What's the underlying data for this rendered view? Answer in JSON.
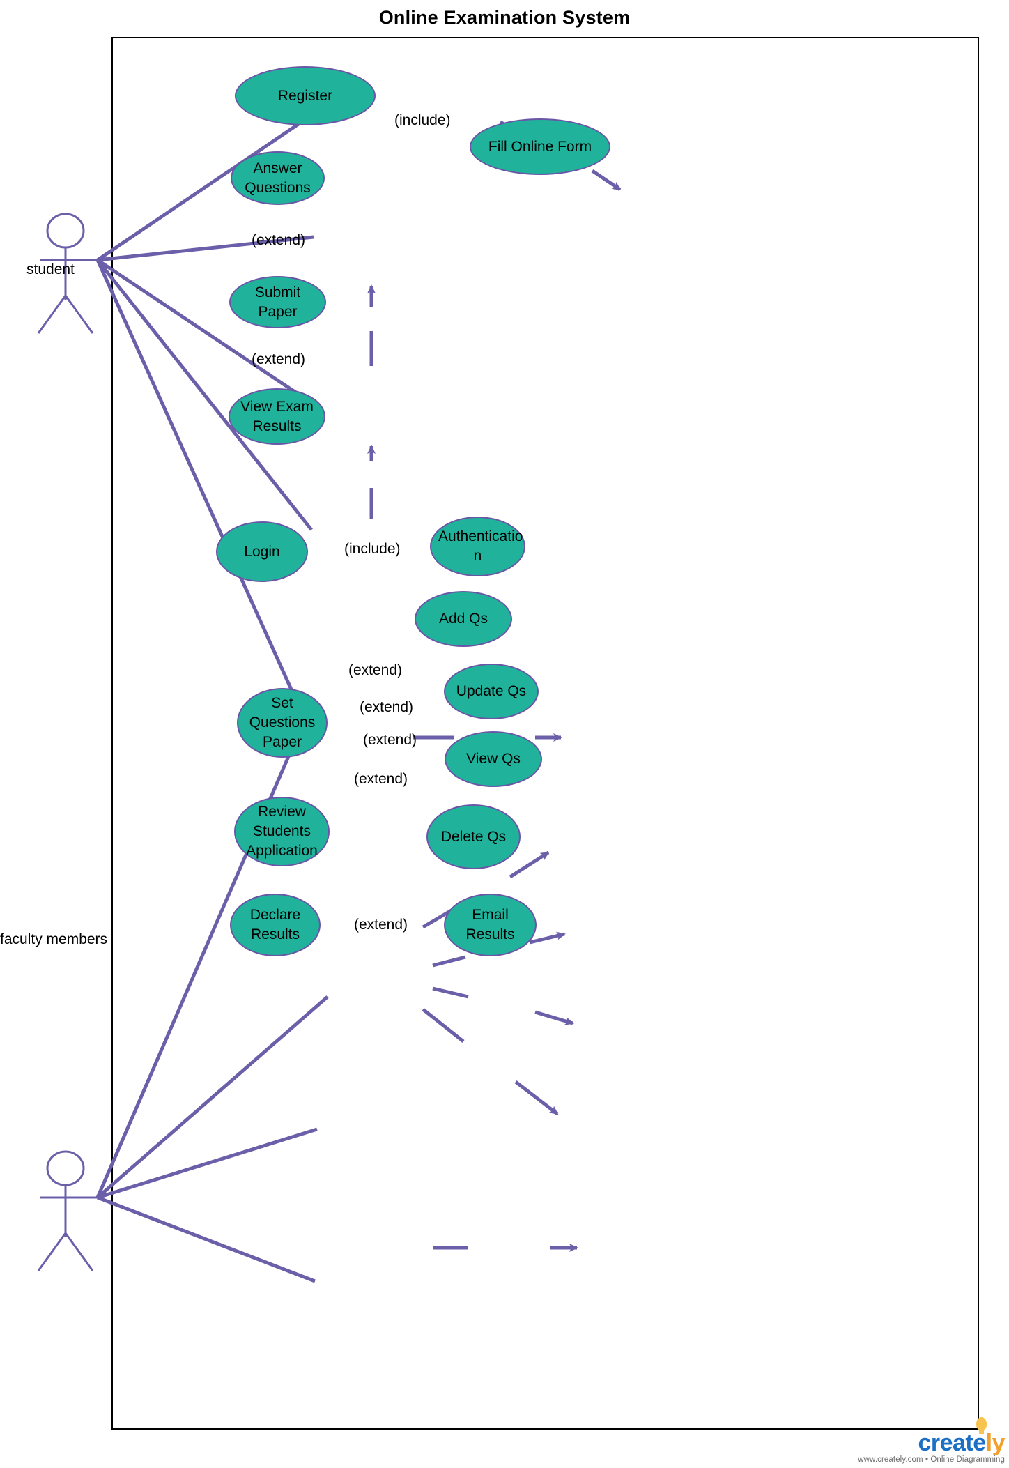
{
  "title": "Online Examination System",
  "actors": [
    {
      "id": "student",
      "label": "student"
    },
    {
      "id": "faculty",
      "label": "faculty members"
    }
  ],
  "use_cases": [
    {
      "id": "register",
      "label": "Register"
    },
    {
      "id": "fill_online_form",
      "label": "Fill Online Form"
    },
    {
      "id": "answer_questions",
      "label": "Answer\nQuestions"
    },
    {
      "id": "submit_paper",
      "label": "Submit Paper"
    },
    {
      "id": "view_exam_results",
      "label": "View Exam\nResults"
    },
    {
      "id": "login",
      "label": "Login"
    },
    {
      "id": "authentication",
      "label": "Authenticatio\nn"
    },
    {
      "id": "add_qs",
      "label": "Add Qs"
    },
    {
      "id": "update_qs",
      "label": "Update Qs"
    },
    {
      "id": "view_qs",
      "label": "View Qs"
    },
    {
      "id": "delete_qs",
      "label": "Delete Qs"
    },
    {
      "id": "set_questions_paper",
      "label": "Set\nQuestions\nPaper"
    },
    {
      "id": "review_students_application",
      "label": "Review\nStudents\nApplication"
    },
    {
      "id": "declare_results",
      "label": "Declare\nResults"
    },
    {
      "id": "email_results",
      "label": "Email\nResults"
    }
  ],
  "relationships": [
    {
      "id": "register_include_form",
      "label": "(include)",
      "from": "register",
      "to": "fill_online_form",
      "type": "include"
    },
    {
      "id": "submit_extend_answer",
      "label": "(extend)",
      "from": "submit_paper",
      "to": "answer_questions",
      "type": "extend"
    },
    {
      "id": "view_extend_submit",
      "label": "(extend)",
      "from": "view_exam_results",
      "to": "submit_paper",
      "type": "extend"
    },
    {
      "id": "login_include_auth",
      "label": "(include)",
      "from": "login",
      "to": "authentication",
      "type": "include"
    },
    {
      "id": "set_extend_add",
      "label": "(extend)",
      "from": "set_questions_paper",
      "to": "add_qs",
      "type": "extend"
    },
    {
      "id": "set_extend_update",
      "label": "(extend)",
      "from": "set_questions_paper",
      "to": "update_qs",
      "type": "extend"
    },
    {
      "id": "set_extend_view",
      "label": "(extend)",
      "from": "set_questions_paper",
      "to": "view_qs",
      "type": "extend"
    },
    {
      "id": "set_extend_delete",
      "label": "(extend)",
      "from": "set_questions_paper",
      "to": "delete_qs",
      "type": "extend"
    },
    {
      "id": "declare_extend_email",
      "label": "(extend)",
      "from": "declare_results",
      "to": "email_results",
      "type": "extend"
    }
  ],
  "associations": [
    {
      "from": "student",
      "to": "register"
    },
    {
      "from": "student",
      "to": "answer_questions"
    },
    {
      "from": "student",
      "to": "submit_paper"
    },
    {
      "from": "student",
      "to": "view_exam_results"
    },
    {
      "from": "student",
      "to": "login"
    },
    {
      "from": "faculty",
      "to": "login"
    },
    {
      "from": "faculty",
      "to": "set_questions_paper"
    },
    {
      "from": "faculty",
      "to": "review_students_application"
    },
    {
      "from": "faculty",
      "to": "declare_results"
    }
  ],
  "watermark": {
    "brand_part1": "creat",
    "brand_part2": "e",
    "brand_part3": "ly",
    "tagline": "www.creately.com • Online Diagramming"
  },
  "colors": {
    "use_case_fill": "#20b29a",
    "use_case_border": "#6a55a6",
    "connector": "#6a5fa8",
    "boundary": "#000000",
    "text": "#000000"
  }
}
